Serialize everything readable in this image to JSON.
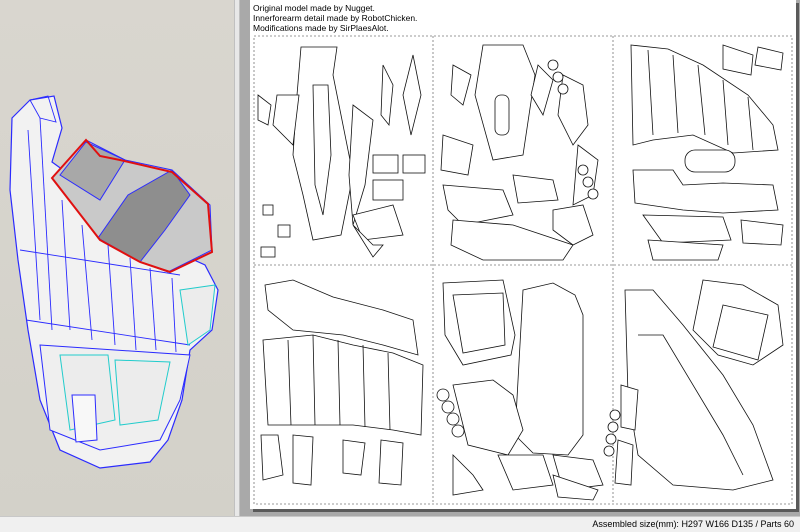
{
  "credits": {
    "line1": "Original model made by Nugget.",
    "line2": "Innerforearm detail made by RobotChicken.",
    "line3": "Modifications made by SirPlaesAlot."
  },
  "statusbar": {
    "assembled": "Assembled size(mm): H297 W166 D135 / Parts 60"
  },
  "colors": {
    "viewport_bg": "#d5d2ca",
    "sheet_bg": "#ffffff",
    "pane_bg": "#a9a9a9",
    "edge_blue": "#2b2bff",
    "edge_red": "#e01010",
    "edge_cyan": "#22cccc"
  }
}
